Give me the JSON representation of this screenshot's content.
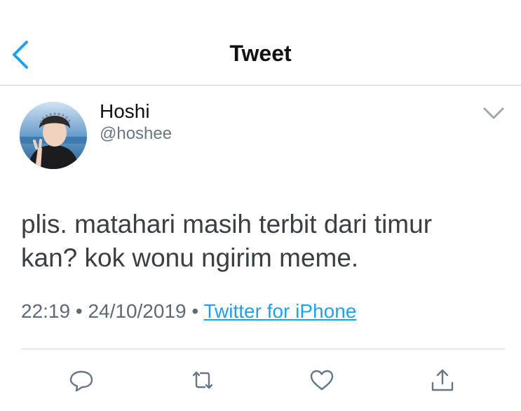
{
  "header": {
    "title": "Tweet"
  },
  "tweet": {
    "name": "Hoshi",
    "handle": "@hoshee",
    "text_line1": "plis. matahari masih terbit dari timur",
    "text_line2": "kan? kok wonu ngirim meme.",
    "time": "22:19",
    "date": "24/10/2019",
    "separator": "•",
    "source": "Twitter for iPhone"
  },
  "icons": {
    "back": "chevron-left-icon",
    "more": "chevron-down-icon",
    "reply": "reply-icon",
    "retweet": "retweet-icon",
    "like": "heart-icon",
    "share": "share-icon"
  },
  "colors": {
    "accent": "#1da1f2",
    "icon": "#657786",
    "text": "#14171a"
  }
}
